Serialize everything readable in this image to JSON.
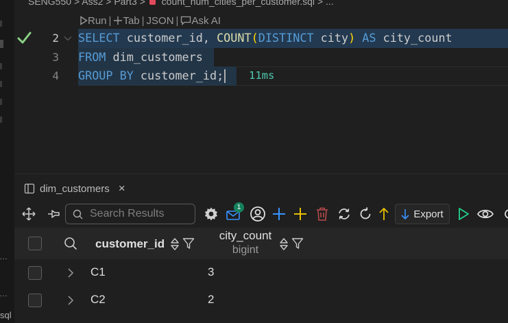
{
  "breadcrumb": {
    "items": [
      "SENG550",
      "Ass2",
      "Part3",
      "count_num_cities_per_customer.sql",
      "..."
    ],
    "separator": ">"
  },
  "codelens": {
    "run": "Run",
    "tab": "Tab",
    "json": "JSON",
    "ask_ai": "Ask AI",
    "separator": "|"
  },
  "editor": {
    "line_numbers": [
      "2",
      "3",
      "4"
    ],
    "lines": [
      {
        "tokens": [
          {
            "text": "SELECT",
            "kind": "keyword"
          },
          {
            "text": " customer_id, ",
            "kind": "ident"
          },
          {
            "text": "COUNT",
            "kind": "function"
          },
          {
            "text": "(",
            "kind": "paren"
          },
          {
            "text": "DISTINCT",
            "kind": "keyword"
          },
          {
            "text": " city",
            "kind": "ident"
          },
          {
            "text": ")",
            "kind": "paren"
          },
          {
            "text": " ",
            "kind": "ident"
          },
          {
            "text": "AS",
            "kind": "keyword"
          },
          {
            "text": " city_count",
            "kind": "ident"
          }
        ]
      },
      {
        "tokens": [
          {
            "text": "FROM",
            "kind": "keyword"
          },
          {
            "text": " dim_customers",
            "kind": "ident"
          }
        ]
      },
      {
        "tokens": [
          {
            "text": "GROUP BY",
            "kind": "keyword"
          },
          {
            "text": " customer_id;",
            "kind": "ident"
          }
        ]
      }
    ],
    "execution_time": "11ms",
    "status_icon": "check-icon"
  },
  "panel": {
    "tab_title": "dim_customers",
    "toolbar": {
      "search_placeholder": "Search Results",
      "notification_count": "1",
      "export_label": "Export"
    },
    "grid": {
      "columns": [
        {
          "name": "customer_id",
          "type": ""
        },
        {
          "name": "city_count",
          "type": "bigint"
        }
      ],
      "rows": [
        [
          "C1",
          "3"
        ],
        [
          "C2",
          "2"
        ]
      ]
    }
  },
  "sidebar": {
    "more_label_1": "...",
    "more_label_2": "...",
    "sql_label": "sql"
  },
  "colors": {
    "keyword": "#569cd6",
    "function": "#dcdcaa",
    "paren": "#ffd700",
    "ident": "#cccccc",
    "timing": "#4ec9b0",
    "check": "#89d185",
    "add_blue": "#3794ff",
    "add_yellow": "#e8c000",
    "delete": "#b84a4a",
    "run": "#23d18b",
    "badge": "#16825d"
  }
}
